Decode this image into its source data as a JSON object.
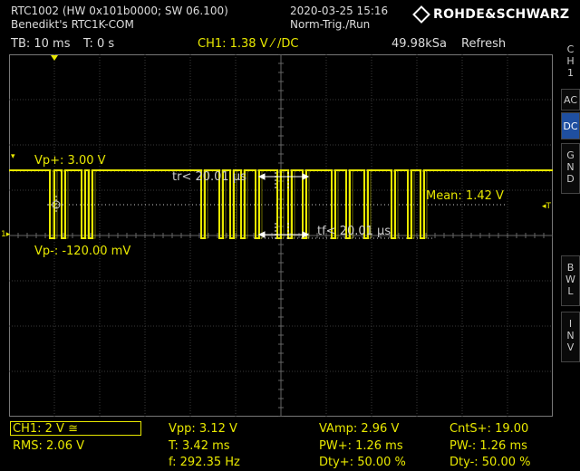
{
  "header": {
    "device": "RTC1002 (HW 0x101b0000; SW 06.100)",
    "user": "Benedikt's RTC1K-COM",
    "datetime": "2020-03-25 15:16",
    "trigger_mode": "Norm-Trig./Run",
    "brand": "ROHDE&SCHWARZ"
  },
  "status": {
    "timebase": "TB: 10 ms",
    "trigger_time": "T: 0 s",
    "channel_trigger": "CH1: 1.38 V ⁄ /DC",
    "sample_rate": "49.98kSa",
    "acq_mode": "Refresh"
  },
  "side_panel": {
    "channel_letters": [
      "C",
      "H",
      "1"
    ],
    "ac": "AC",
    "dc": "DC",
    "gnd": [
      "G",
      "N",
      "D"
    ],
    "bwl": [
      "B",
      "W",
      "L"
    ],
    "inv": [
      "I",
      "N",
      "V"
    ]
  },
  "waveform_labels": {
    "vp_plus": "Vp+: 3.00 V",
    "vp_minus": "Vp-: -120.00 mV",
    "rise_time": "tr< 20.01 µs",
    "fall_time": "tf< 20.01 µs",
    "mean": "Mean: 1.42 V",
    "ground_marker": "1",
    "trigger_marker": "T"
  },
  "measurements": {
    "ch_scale": "CH1: 2 V ≅",
    "rms": "RMS: 2.06 V",
    "vpp": "Vpp: 3.12 V",
    "period": "T: 3.42 ms",
    "freq": "f: 292.35 Hz",
    "vamp": "VAmp: 2.96 V",
    "pw_plus": "PW+: 1.26 ms",
    "duty_plus": "Dty+: 50.00 %",
    "cnt_s_plus": "CntS+: 19.00",
    "pw_minus": "PW-: 1.26 ms",
    "duty_minus": "Dty-: 50.00 %"
  },
  "colors": {
    "trace": "#e8e800",
    "grid": "#3a3a3a",
    "accent": "#1f4fa0"
  }
}
